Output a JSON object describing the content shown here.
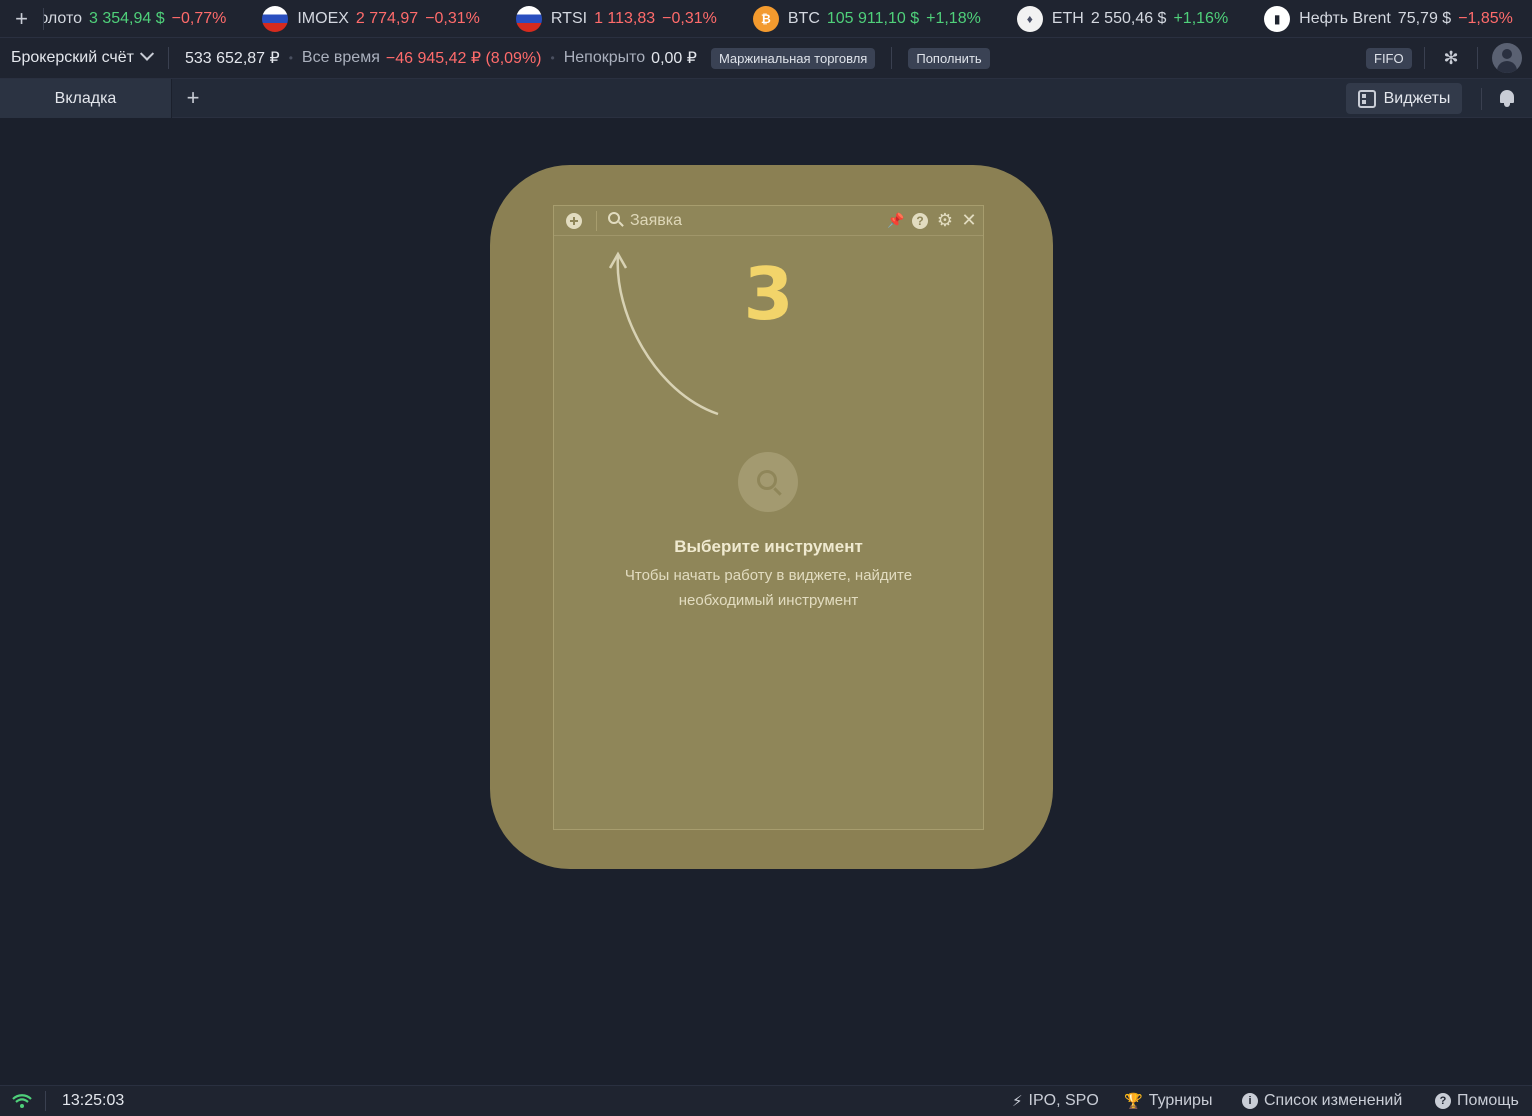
{
  "ticker": {
    "items": [
      {
        "name": "Золото",
        "price": "3 354,94 $",
        "change": "−0,77%",
        "price_dir": "pos",
        "change_dir": "neg",
        "icon": "gold-icon"
      },
      {
        "name": "IMOEX",
        "price": "2 774,97",
        "change": "−0,31%",
        "price_dir": "neg",
        "change_dir": "neg",
        "icon": "russia-flag-icon"
      },
      {
        "name": "RTSI",
        "price": "1 113,83",
        "change": "−0,31%",
        "price_dir": "neg",
        "change_dir": "neg",
        "icon": "russia-flag-icon"
      },
      {
        "name": "BTC",
        "price": "105 911,10 $",
        "change": "+1,18%",
        "price_dir": "pos",
        "change_dir": "pos",
        "icon": "bitcoin-icon"
      },
      {
        "name": "ETH",
        "price": "2 550,46 $",
        "change": "+1,16%",
        "price_dir": "neutral",
        "change_dir": "pos",
        "icon": "ethereum-icon"
      },
      {
        "name": "Нефть Brent",
        "price": "75,79 $",
        "change": "−1,85%",
        "price_dir": "neutral",
        "change_dir": "neg",
        "icon": "oil-icon"
      }
    ]
  },
  "account": {
    "selector_label": "Брокерский счёт",
    "balance": "533 652,87 ₽",
    "alltime_label": "Все время",
    "alltime_value": "−46 945,42 ₽ (8,09%)",
    "uncovered_label": "Непокрыто",
    "uncovered_value": "0,00 ₽",
    "margin_label": "Маржинальная торговля",
    "deposit_label": "Пополнить",
    "fifo_label": "FIFO"
  },
  "tabs": {
    "items": [
      {
        "label": "Вкладка"
      }
    ],
    "add_symbol": "+",
    "widgets_label": "Виджеты"
  },
  "widget": {
    "search_placeholder": "Заявка",
    "step_number": "3",
    "empty_title": "Выберите инструмент",
    "empty_text": "Чтобы начать работу в виджете, найдите необходимый инструмент"
  },
  "status": {
    "time": "13:25:03",
    "links": [
      {
        "label": "IPO, SPO",
        "icon": "lightning-icon"
      },
      {
        "label": "Турниры",
        "icon": "trophy-icon"
      },
      {
        "label": "Список изменений",
        "icon": "info-icon"
      },
      {
        "label": "Помощь",
        "icon": "help-icon"
      }
    ]
  },
  "colors": {
    "background": "#1b202c",
    "positive": "#4fd07a",
    "negative": "#ff6b6b",
    "highlight": "#8b8053",
    "step_number": "#f2d46a"
  }
}
